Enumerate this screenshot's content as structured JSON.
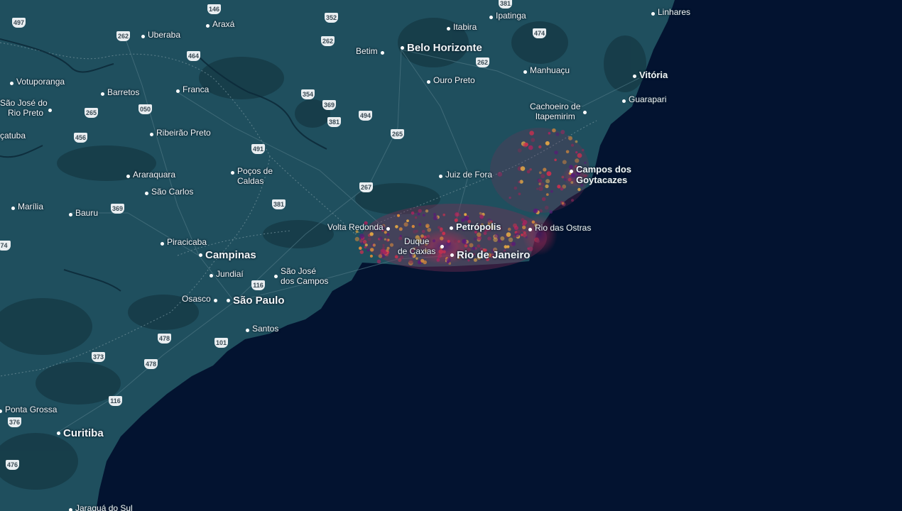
{
  "map": {
    "colors": {
      "ocean": "#031330",
      "land": "#1f4f5e",
      "land_dark": "#163b47",
      "hot": "#c7304f",
      "hottest": "#6a1d7a",
      "warm": "#d88a3b"
    },
    "cities": [
      {
        "id": "linhares",
        "label": "Linhares"
      },
      {
        "id": "ipatinga",
        "label": "Ipatinga"
      },
      {
        "id": "itabira",
        "label": "Itabira"
      },
      {
        "id": "uberaba",
        "label": "Uberaba"
      },
      {
        "id": "araxa",
        "label": "Araxá"
      },
      {
        "id": "betim",
        "label": "Betim"
      },
      {
        "id": "belo-horizonte",
        "label": "Belo Horizonte"
      },
      {
        "id": "manhuacu",
        "label": "Manhuaçu"
      },
      {
        "id": "vitoria",
        "label": "Vitória"
      },
      {
        "id": "votuporanga",
        "label": "Votuporanga"
      },
      {
        "id": "barretos",
        "label": "Barretos"
      },
      {
        "id": "franca",
        "label": "Franca"
      },
      {
        "id": "ouro-preto",
        "label": "Ouro Preto"
      },
      {
        "id": "guarapari",
        "label": "Guarapari"
      },
      {
        "id": "sao-jose-rio-preto-1",
        "label": "São José do"
      },
      {
        "id": "sao-jose-rio-preto-2",
        "label": "Rio Preto"
      },
      {
        "id": "cachoeiro-1",
        "label": "Cachoeiro de"
      },
      {
        "id": "cachoeiro-2",
        "label": "Itapemirim"
      },
      {
        "id": "catuba",
        "label": "çatuba"
      },
      {
        "id": "ribeirao-preto",
        "label": "Ribeirão Preto"
      },
      {
        "id": "araraquara",
        "label": "Araraquara"
      },
      {
        "id": "pocos-1",
        "label": "Poços de"
      },
      {
        "id": "pocos-2",
        "label": "Caldas"
      },
      {
        "id": "juiz-de-fora",
        "label": "Juiz de Fora"
      },
      {
        "id": "campos-1",
        "label": "Campos dos"
      },
      {
        "id": "campos-2",
        "label": "Goytacazes"
      },
      {
        "id": "sao-carlos",
        "label": "São Carlos"
      },
      {
        "id": "marilia",
        "label": "Marília"
      },
      {
        "id": "bauru",
        "label": "Bauru"
      },
      {
        "id": "volta-redonda",
        "label": "Volta Redonda"
      },
      {
        "id": "petropolis",
        "label": "Petrópolis"
      },
      {
        "id": "rio-das-ostras",
        "label": "Rio das Ostras"
      },
      {
        "id": "piracicaba",
        "label": "Piracicaba"
      },
      {
        "id": "duque-1",
        "label": "Duque"
      },
      {
        "id": "duque-2",
        "label": "de Caxias"
      },
      {
        "id": "campinas",
        "label": "Campinas"
      },
      {
        "id": "rio-de-janeiro",
        "label": "Rio de Janeiro"
      },
      {
        "id": "jundiai",
        "label": "Jundiaí"
      },
      {
        "id": "sjc-1",
        "label": "São José"
      },
      {
        "id": "sjc-2",
        "label": "dos Campos"
      },
      {
        "id": "osasco",
        "label": "Osasco"
      },
      {
        "id": "sao-paulo",
        "label": "São Paulo"
      },
      {
        "id": "santos",
        "label": "Santos"
      },
      {
        "id": "ponta-grossa",
        "label": "Ponta Grossa"
      },
      {
        "id": "curitiba",
        "label": "Curitiba"
      },
      {
        "id": "jaragua",
        "label": "Jaraguá do Sul"
      }
    ],
    "shields": [
      "146",
      "352",
      "381",
      "497",
      "262",
      "464",
      "262",
      "474",
      "262",
      "354",
      "369",
      "381",
      "494",
      "265",
      "050",
      "265",
      "456",
      "491",
      "265",
      "267",
      "381",
      "369",
      "116",
      "478",
      "101",
      "373",
      "478",
      "116",
      "376",
      "476",
      "74"
    ]
  }
}
